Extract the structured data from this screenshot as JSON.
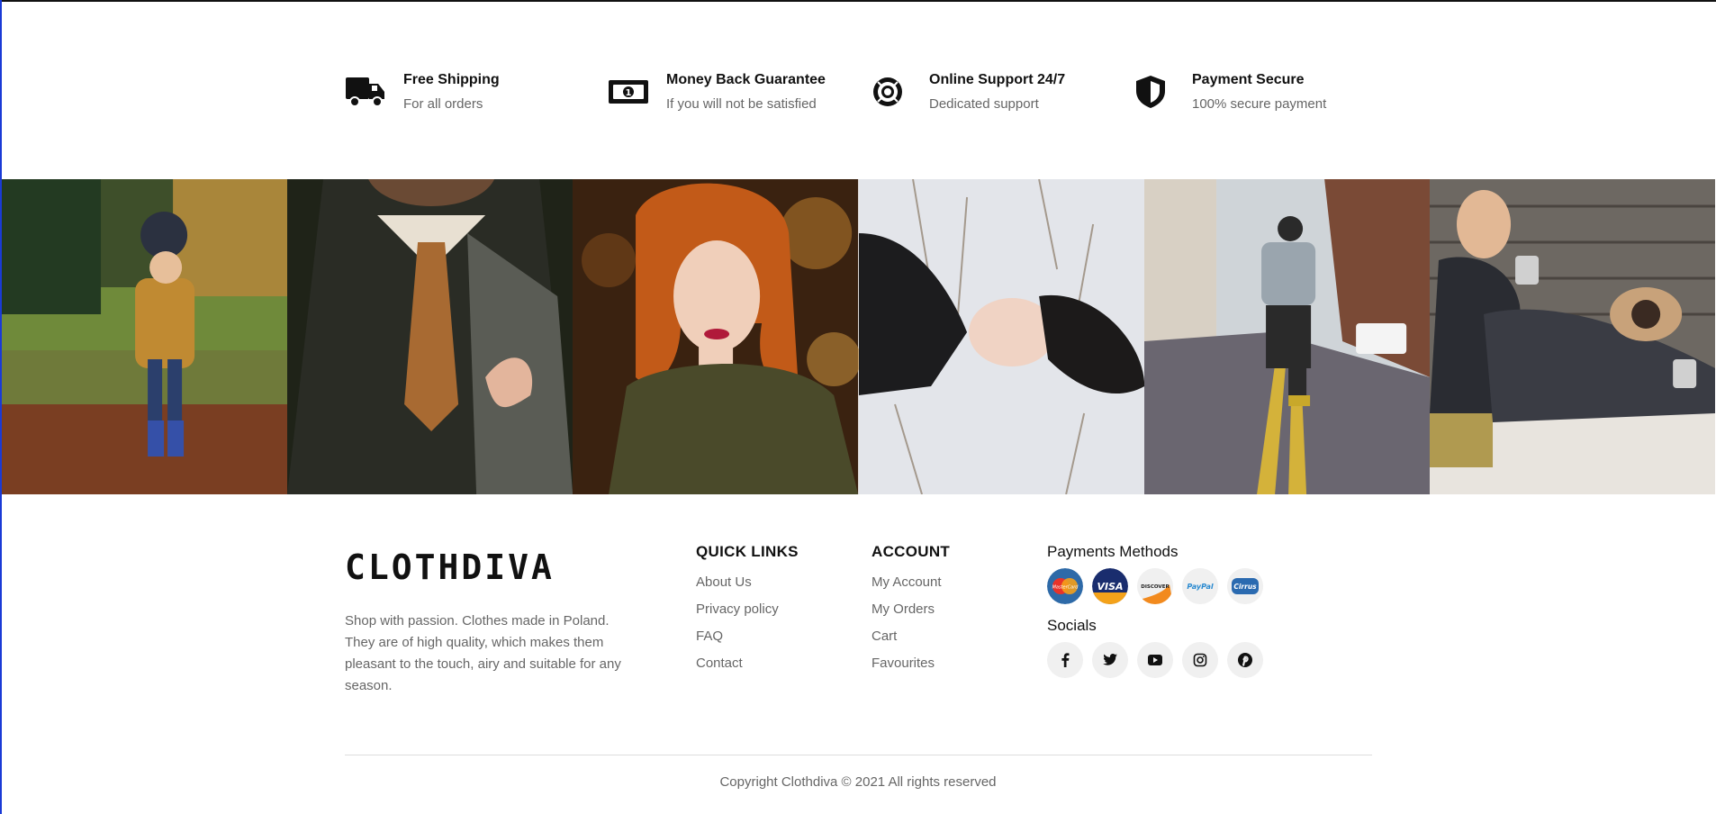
{
  "features": [
    {
      "title": "Free Shipping",
      "subtitle": "For all orders",
      "icon": "truck-icon"
    },
    {
      "title": "Money Back Guarantee",
      "subtitle": "If you will not be satisfied",
      "icon": "money-icon"
    },
    {
      "title": "Online Support 24/7",
      "subtitle": "Dedicated support",
      "icon": "lifebuoy-icon"
    },
    {
      "title": "Payment Secure",
      "subtitle": "100% secure payment",
      "icon": "shield-icon"
    }
  ],
  "gallery": [
    {
      "subject": "child-in-autumn-leaves"
    },
    {
      "subject": "man-in-suit-tie"
    },
    {
      "subject": "redhead-woman-in-jacket"
    },
    {
      "subject": "woman-lying-in-snow"
    },
    {
      "subject": "man-jumping-in-street"
    },
    {
      "subject": "man-with-pug-and-mug"
    }
  ],
  "footer": {
    "logo": "CLOTHDIVA",
    "description": "Shop with passion. Clothes made in Poland. They are of high quality, which makes them pleasant to the touch, airy and suitable for any season.",
    "quick_links": {
      "title": "QUICK LINKS",
      "items": [
        "About Us",
        "Privacy policy",
        "FAQ",
        "Contact"
      ]
    },
    "account": {
      "title": "ACCOUNT",
      "items": [
        "My Account",
        "My Orders",
        "Cart",
        "Favourites"
      ]
    },
    "payments": {
      "title": "Payments Methods",
      "methods": [
        "MasterCard",
        "VISA",
        "DISCOVER",
        "PayPal",
        "Cirrus"
      ]
    },
    "socials": {
      "title": "Socials",
      "items": [
        "facebook-icon",
        "twitter-icon",
        "youtube-icon",
        "instagram-icon",
        "pinterest-icon"
      ]
    },
    "copyright": "Copyright Clothdiva © 2021 All rights reserved"
  },
  "colors": {
    "text": "#111111",
    "muted": "#666666",
    "circle_bg": "#f0f0f0",
    "left_edge": "#1a3ad6"
  }
}
